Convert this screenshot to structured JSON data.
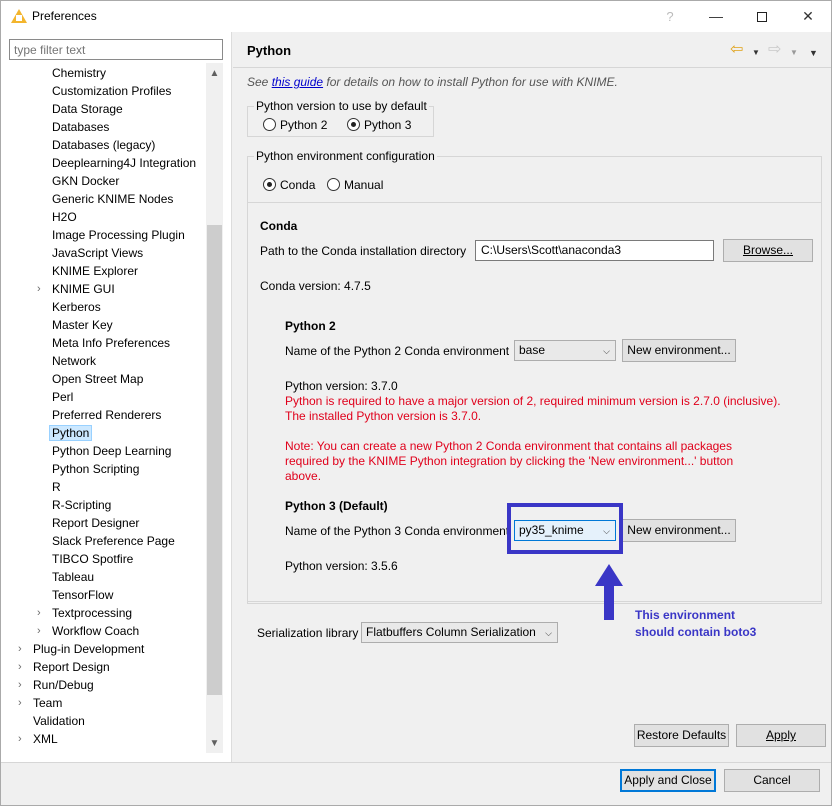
{
  "window": {
    "title": "Preferences",
    "help_glyph": "?",
    "minimize_glyph": "—",
    "close_glyph": "✕"
  },
  "filter": {
    "placeholder": "type filter text",
    "value": ""
  },
  "tree": {
    "items": [
      {
        "label": "Chemistry",
        "level": 2,
        "expandable": false
      },
      {
        "label": "Customization Profiles",
        "level": 2,
        "expandable": false
      },
      {
        "label": "Data Storage",
        "level": 2,
        "expandable": false
      },
      {
        "label": "Databases",
        "level": 2,
        "expandable": false
      },
      {
        "label": "Databases (legacy)",
        "level": 2,
        "expandable": false
      },
      {
        "label": "Deeplearning4J Integration",
        "level": 2,
        "expandable": false
      },
      {
        "label": "GKN Docker",
        "level": 2,
        "expandable": false
      },
      {
        "label": "Generic KNIME Nodes",
        "level": 2,
        "expandable": false
      },
      {
        "label": "H2O",
        "level": 2,
        "expandable": false
      },
      {
        "label": "Image Processing Plugin",
        "level": 2,
        "expandable": false
      },
      {
        "label": "JavaScript Views",
        "level": 2,
        "expandable": false
      },
      {
        "label": "KNIME Explorer",
        "level": 2,
        "expandable": false
      },
      {
        "label": "KNIME GUI",
        "level": 2,
        "expandable": true
      },
      {
        "label": "Kerberos",
        "level": 2,
        "expandable": false
      },
      {
        "label": "Master Key",
        "level": 2,
        "expandable": false
      },
      {
        "label": "Meta Info Preferences",
        "level": 2,
        "expandable": false
      },
      {
        "label": "Network",
        "level": 2,
        "expandable": false
      },
      {
        "label": "Open Street Map",
        "level": 2,
        "expandable": false
      },
      {
        "label": "Perl",
        "level": 2,
        "expandable": false
      },
      {
        "label": "Preferred Renderers",
        "level": 2,
        "expandable": false
      },
      {
        "label": "Python",
        "level": 2,
        "expandable": false,
        "selected": true
      },
      {
        "label": "Python Deep Learning",
        "level": 2,
        "expandable": false
      },
      {
        "label": "Python Scripting",
        "level": 2,
        "expandable": false
      },
      {
        "label": "R",
        "level": 2,
        "expandable": false
      },
      {
        "label": "R-Scripting",
        "level": 2,
        "expandable": false
      },
      {
        "label": "Report Designer",
        "level": 2,
        "expandable": false
      },
      {
        "label": "Slack Preference Page",
        "level": 2,
        "expandable": false
      },
      {
        "label": "TIBCO Spotfire",
        "level": 2,
        "expandable": false
      },
      {
        "label": "Tableau",
        "level": 2,
        "expandable": false
      },
      {
        "label": "TensorFlow",
        "level": 2,
        "expandable": false
      },
      {
        "label": "Textprocessing",
        "level": 2,
        "expandable": true
      },
      {
        "label": "Workflow Coach",
        "level": 2,
        "expandable": true
      },
      {
        "label": "Plug-in Development",
        "level": 1,
        "expandable": true
      },
      {
        "label": "Report Design",
        "level": 1,
        "expandable": true
      },
      {
        "label": "Run/Debug",
        "level": 1,
        "expandable": true
      },
      {
        "label": "Team",
        "level": 1,
        "expandable": true
      },
      {
        "label": "Validation",
        "level": 1,
        "expandable": false
      },
      {
        "label": "XML",
        "level": 1,
        "expandable": true
      }
    ]
  },
  "page": {
    "title": "Python",
    "info_prefix": "See ",
    "info_link": "this guide",
    "info_suffix": " for details on how to install Python for use with KNIME.",
    "version_group": {
      "legend": "Python version to use by default",
      "option_python2": "Python 2",
      "option_python3": "Python 3",
      "selected": "Python 3"
    },
    "env_group": {
      "legend": "Python environment configuration",
      "option_conda": "Conda",
      "option_manual": "Manual",
      "selected": "Conda"
    },
    "conda": {
      "heading": "Conda",
      "path_label": "Path to the Conda installation directory",
      "path_value": "C:\\Users\\Scott\\anaconda3",
      "browse_label": "Browse...",
      "version_text": "Conda version: 4.7.5"
    },
    "python2": {
      "heading": "Python 2",
      "env_label": "Name of the Python 2 Conda environment",
      "env_value": "base",
      "new_env_label": "New environment...",
      "version_text": "Python version: 3.7.0",
      "error_line1": "Python is required to have a major version of 2, required minimum version is 2.7.0 (inclusive).",
      "error_line2": "The installed Python version is 3.7.0.",
      "note_line1": "Note: You can create a new Python 2 Conda environment that contains all packages",
      "note_line2": "required by the KNIME Python integration by clicking the 'New environment...' button",
      "note_line3": "above."
    },
    "python3": {
      "heading": "Python 3 (Default)",
      "env_label": "Name of the Python 3 Conda environment",
      "env_value": "py35_knime",
      "new_env_label": "New environment...",
      "version_text": "Python version: 3.5.6"
    },
    "serialization": {
      "label": "Serialization library",
      "value": "Flatbuffers Column Serialization"
    },
    "annotation": {
      "line1": "This environment",
      "line2": "should contain boto3",
      "color": "#3a36c6"
    },
    "restore_defaults_label": "Restore Defaults",
    "apply_label": "Apply"
  },
  "footer": {
    "apply_close_label": "Apply and Close",
    "cancel_label": "Cancel"
  },
  "colors": {
    "error_red": "#e0001b",
    "selection": "#cce8ff",
    "accent_blue": "#0078d7"
  }
}
